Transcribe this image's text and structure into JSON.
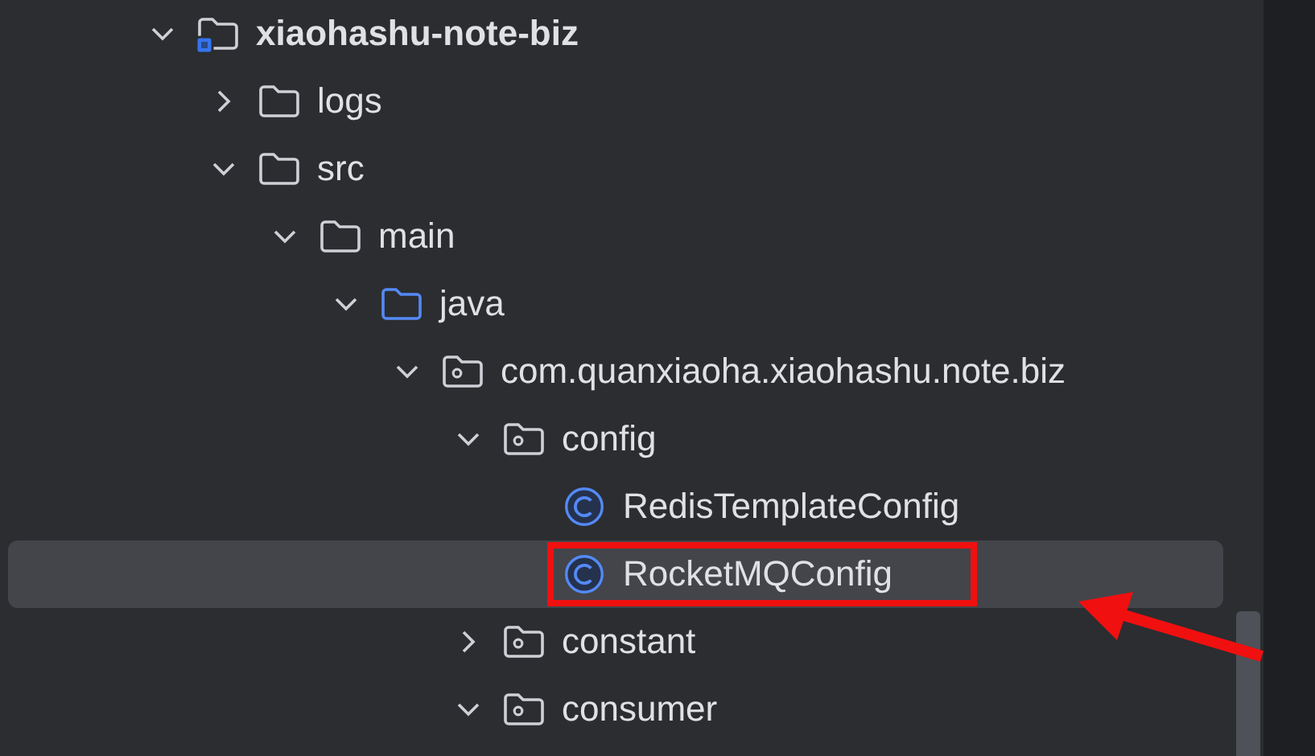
{
  "project_tree": [
    {
      "kind": "module",
      "label": "xiaohashu-note-biz",
      "expanded": true,
      "selected": false,
      "children": [
        {
          "kind": "folder",
          "label": "logs",
          "expanded": false,
          "selected": false
        },
        {
          "kind": "folder",
          "label": "src",
          "expanded": true,
          "selected": false,
          "children": [
            {
              "kind": "folder",
              "label": "main",
              "expanded": true,
              "selected": false,
              "children": [
                {
                  "kind": "source-folder",
                  "label": "java",
                  "expanded": true,
                  "selected": false,
                  "children": [
                    {
                      "kind": "package",
                      "label": "com.quanxiaoha.xiaohashu.note.biz",
                      "expanded": true,
                      "selected": false,
                      "children": [
                        {
                          "kind": "package",
                          "label": "config",
                          "expanded": true,
                          "selected": false,
                          "children": [
                            {
                              "kind": "class",
                              "label": "RedisTemplateConfig",
                              "selected": false,
                              "highlighted": false
                            },
                            {
                              "kind": "class",
                              "label": "RocketMQConfig",
                              "selected": true,
                              "highlighted": true
                            }
                          ]
                        },
                        {
                          "kind": "package",
                          "label": "constant",
                          "expanded": false,
                          "selected": false
                        },
                        {
                          "kind": "package",
                          "label": "consumer",
                          "expanded": true,
                          "selected": false
                        }
                      ]
                    }
                  ]
                }
              ]
            }
          ]
        }
      ]
    }
  ]
}
